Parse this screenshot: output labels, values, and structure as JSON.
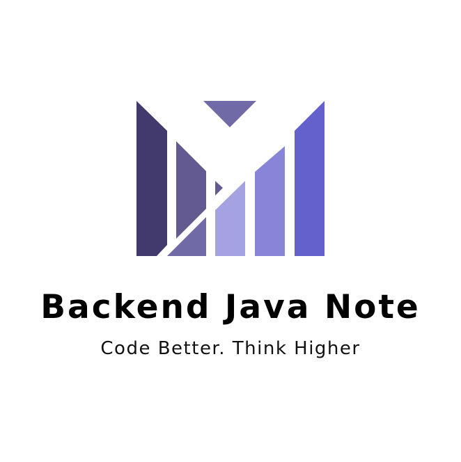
{
  "brand": {
    "title": "Backend Java Note",
    "tagline": "Code Better. Think Higher"
  },
  "logo": {
    "icon": "m-bar-logo-icon",
    "colors": {
      "bar_dark": "#423a6c",
      "bar_mid_dark": "#625a90",
      "wedge": "#706aa7",
      "bar_light": "#a4a2e1",
      "bar_mid_light": "#8885d8",
      "bar_bright": "#6561cc"
    }
  }
}
